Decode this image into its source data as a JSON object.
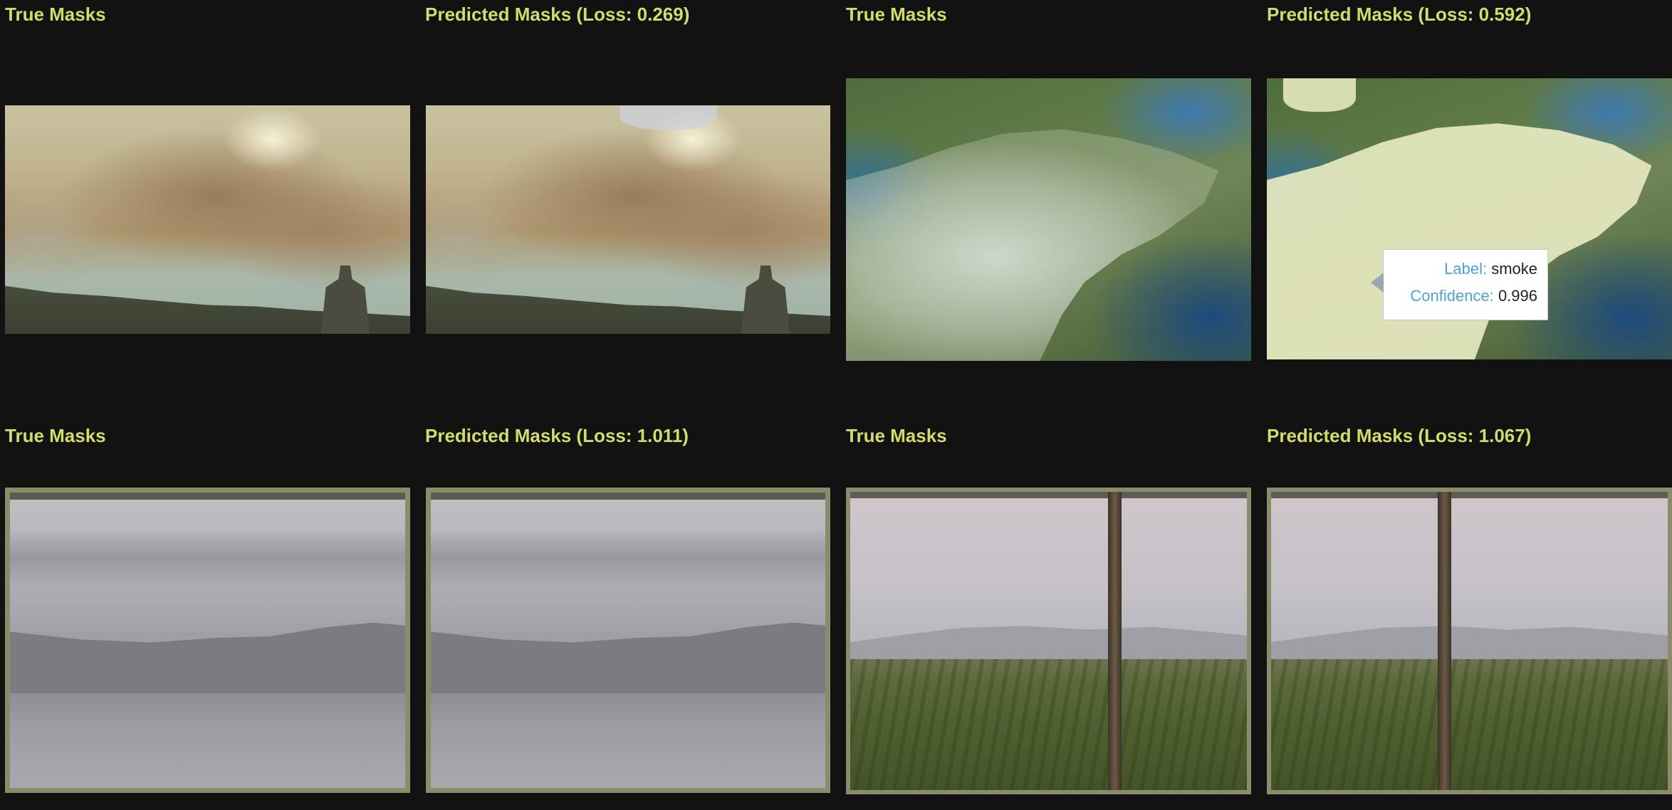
{
  "panels": [
    {
      "title": "True Masks"
    },
    {
      "title": "Predicted Masks (Loss: 0.269)"
    },
    {
      "title": "True Masks"
    },
    {
      "title": "Predicted Masks (Loss: 0.592)"
    },
    {
      "title": "True Masks"
    },
    {
      "title": "Predicted Masks (Loss: 1.011)"
    },
    {
      "title": "True Masks"
    },
    {
      "title": "Predicted Masks (Loss: 1.067)"
    }
  ],
  "tooltip": {
    "label_key": "Label:",
    "label_value": "smoke",
    "confidence_key": "Confidence:",
    "confidence_value": "0.996"
  },
  "colors": {
    "background": "#121212",
    "title": "#d2dc6a",
    "tooltip_key": "#4aa3d8"
  }
}
